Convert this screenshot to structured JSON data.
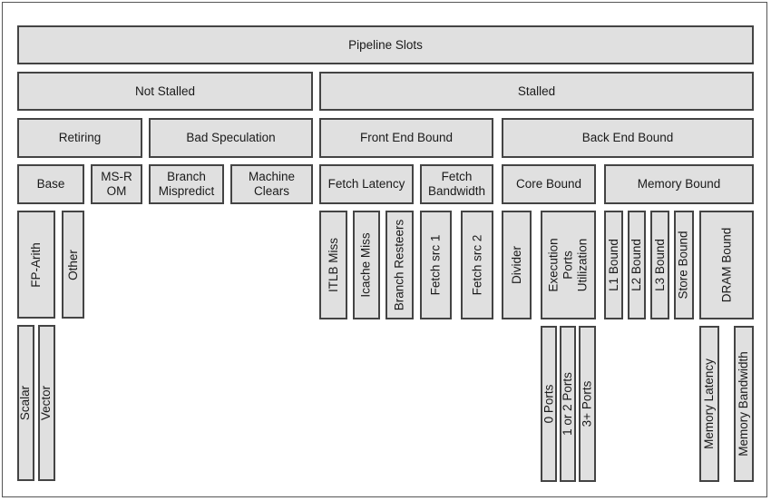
{
  "diagram": {
    "title": "Pipeline Slots",
    "level1": {
      "not_stalled": "Not Stalled",
      "stalled": "Stalled"
    },
    "level2": {
      "retiring": "Retiring",
      "bad_speculation": "Bad Speculation",
      "front_end_bound": "Front End Bound",
      "back_end_bound": "Back End Bound"
    },
    "level3": {
      "base": "Base",
      "ms_rom": "MS-ROM",
      "branch_mispredict": "Branch Mispredict",
      "machine_clears": "Machine Clears",
      "fetch_latency": "Fetch Latency",
      "fetch_bandwidth": "Fetch Bandwidth",
      "core_bound": "Core Bound",
      "memory_bound": "Memory Bound"
    },
    "level4": {
      "fp_arith": "FP-Arith",
      "other": "Other",
      "itlb_miss": "ITLB Miss",
      "icache_miss": "Icache Miss",
      "branch_resteers": "Branch Resteers",
      "fetch_src_1": "Fetch src 1",
      "fetch_src_2": "Fetch src 2",
      "divider": "Divider",
      "execution_ports_utilization": "Execution Ports Utilization",
      "l1_bound": "L1 Bound",
      "l2_bound": "L2 Bound",
      "l3_bound": "L3 Bound",
      "store_bound": "Store Bound",
      "dram_bound": "DRAM Bound"
    },
    "level5": {
      "scalar": "Scalar",
      "vector": "Vector",
      "ports_0": "0 Ports",
      "ports_1_or_2": "1 or 2 Ports",
      "ports_3_plus": "3+ Ports",
      "memory_latency": "Memory Latency",
      "memory_bandwidth": "Memory Bandwidth"
    }
  }
}
